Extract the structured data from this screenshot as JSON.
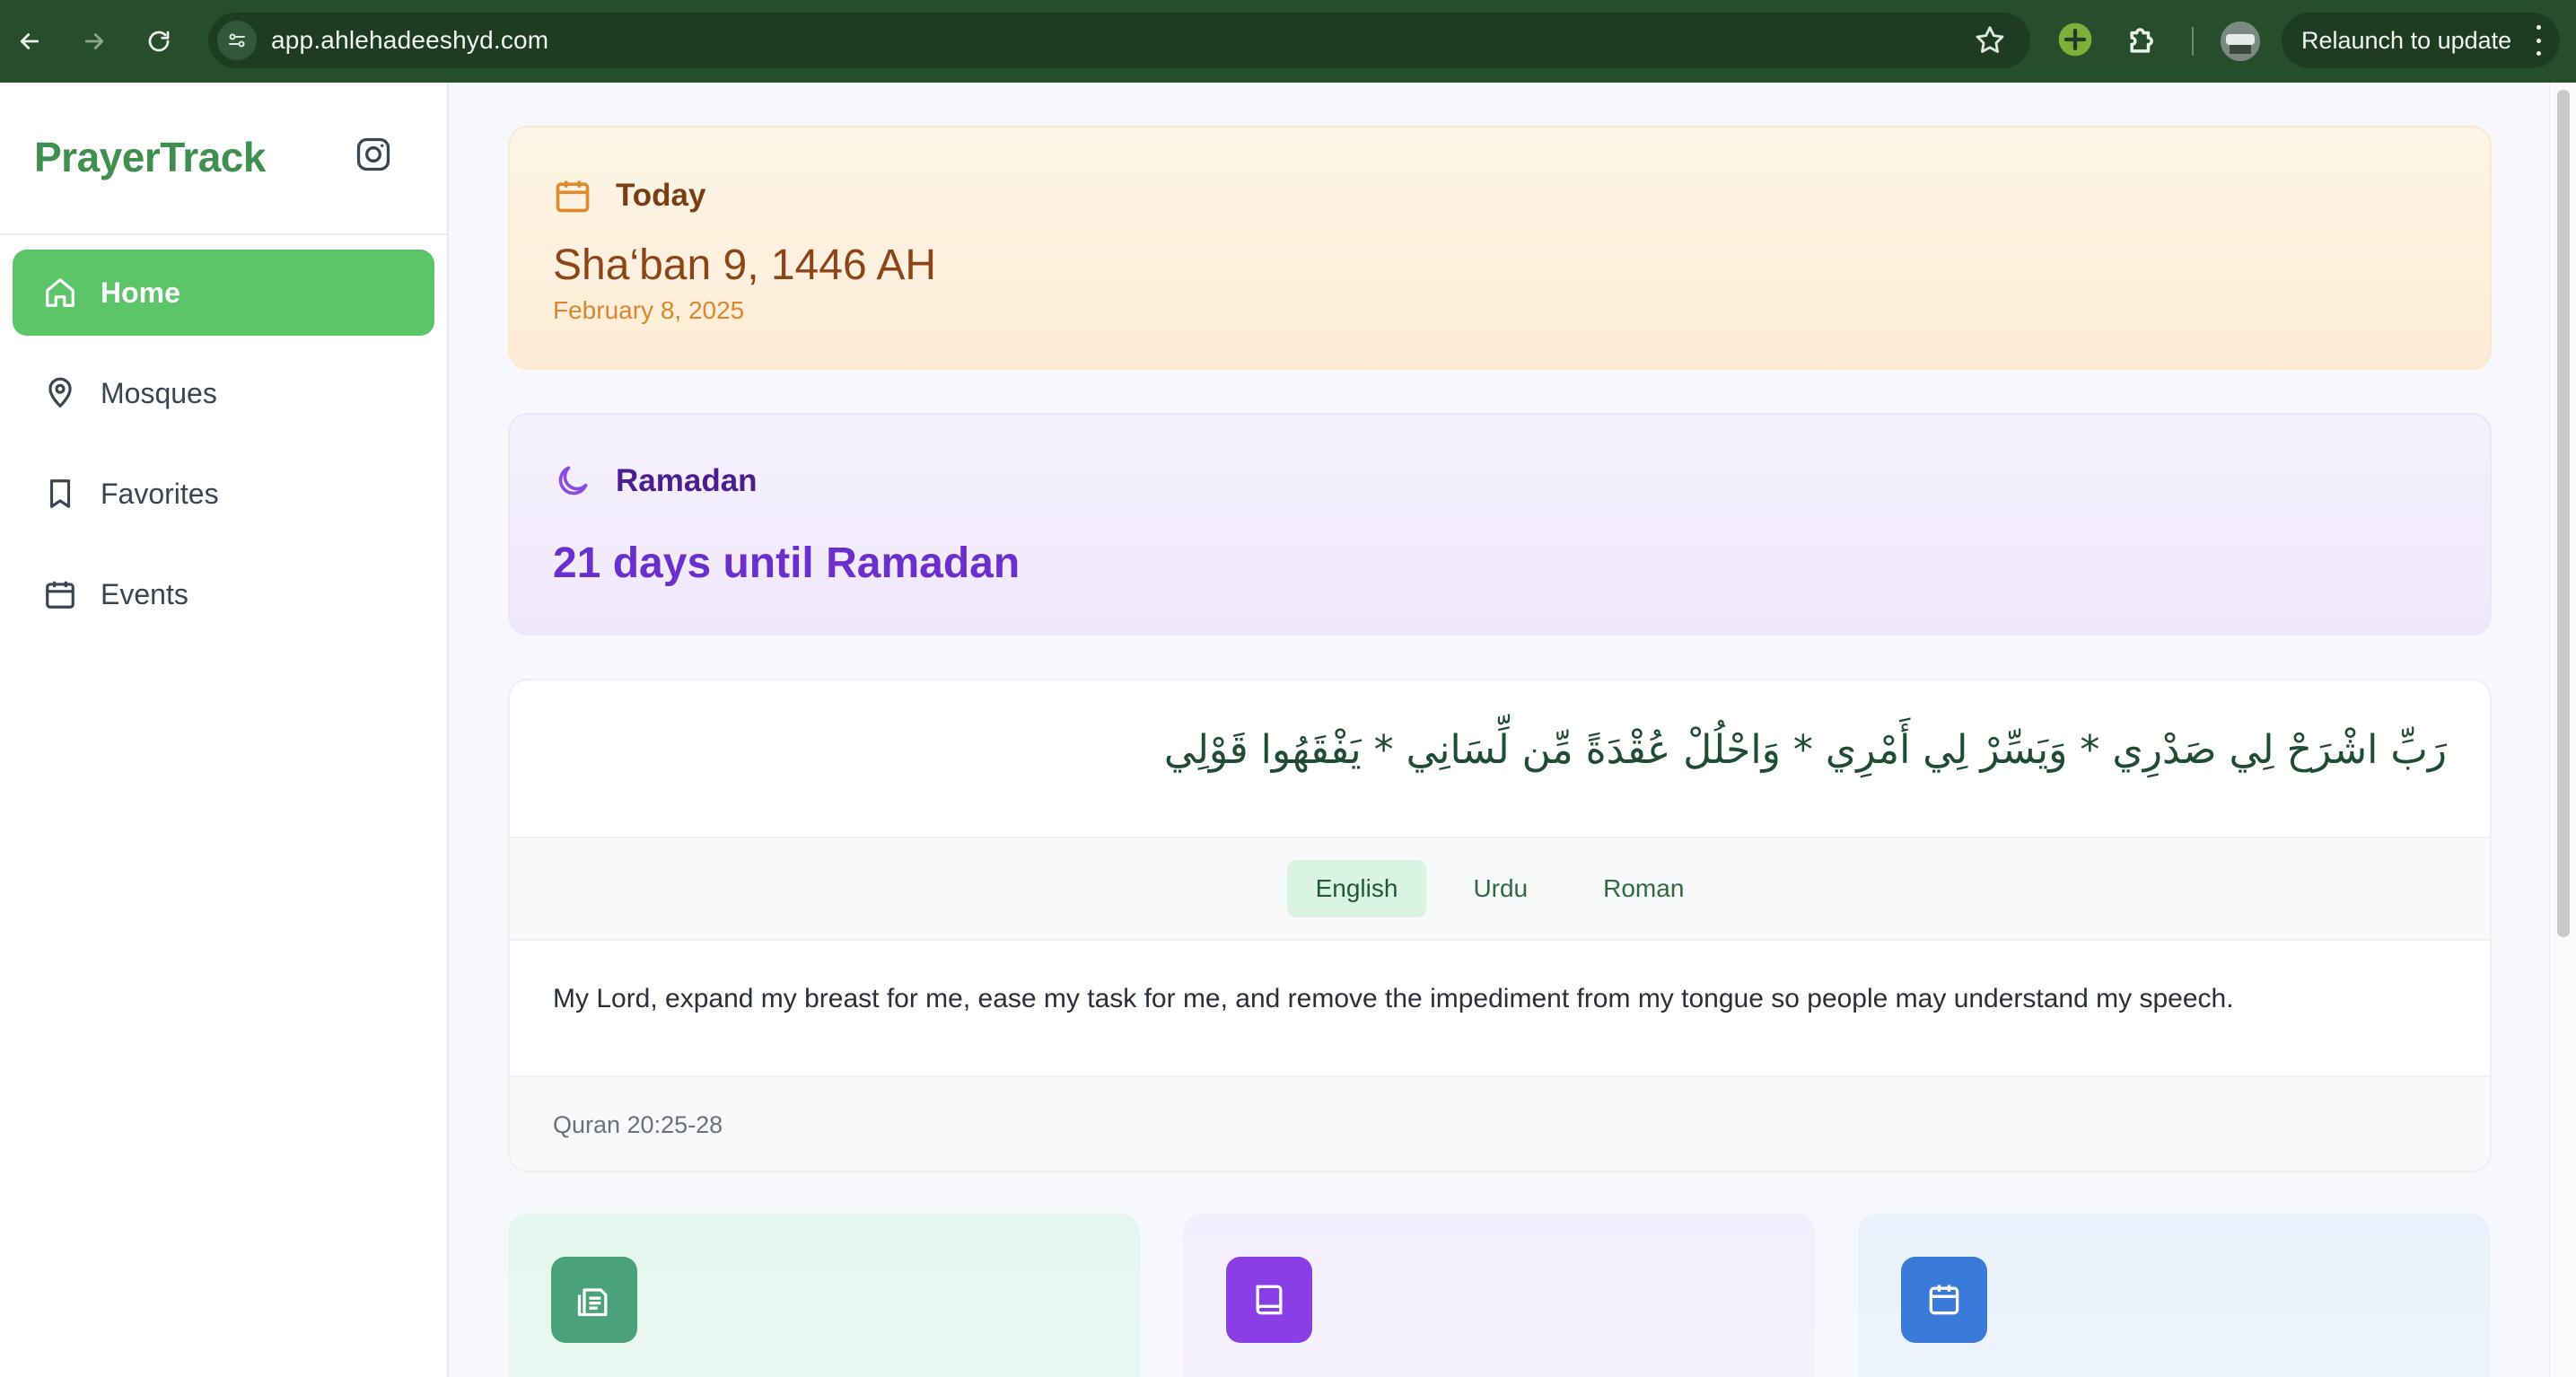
{
  "browser": {
    "url": "app.ahlehadeeshyd.com",
    "relaunch_label": "Relaunch to update"
  },
  "sidebar": {
    "brand": "PrayerTrack",
    "items": [
      {
        "label": "Home",
        "icon": "home-icon",
        "active": true
      },
      {
        "label": "Mosques",
        "icon": "map-pin-icon",
        "active": false
      },
      {
        "label": "Favorites",
        "icon": "bookmark-icon",
        "active": false
      },
      {
        "label": "Events",
        "icon": "calendar-icon",
        "active": false
      }
    ]
  },
  "today": {
    "title": "Today",
    "hijri_date": "Sha‘ban 9, 1446 AH",
    "gregorian_date": "February 8, 2025"
  },
  "ramadan": {
    "title": "Ramadan",
    "countdown": "21 days until Ramadan"
  },
  "dua": {
    "arabic": "رَبِّ اشْرَحْ لِي صَدْرِي * وَيَسِّرْ لِي أَمْرِي * وَاحْلُلْ عُقْدَةً مِّن لِّسَانِي * يَفْقَهُوا قَوْلِي",
    "tabs": [
      "English",
      "Urdu",
      "Roman"
    ],
    "active_tab": "English",
    "translation": "My Lord, expand my breast for me, ease my task for me, and remove the impediment from my tongue so people may understand my speech.",
    "reference": "Quran 20:25-28"
  },
  "tiles": [
    {
      "icon": "document-icon",
      "color": "#4aa27a"
    },
    {
      "icon": "book-icon",
      "color": "#8a3fe6"
    },
    {
      "icon": "calendar-icon",
      "color": "#3a7bd9"
    }
  ],
  "colors": {
    "brand": "#3f8f4f",
    "active_nav": "#5cc568",
    "chrome": "#274e2a"
  }
}
